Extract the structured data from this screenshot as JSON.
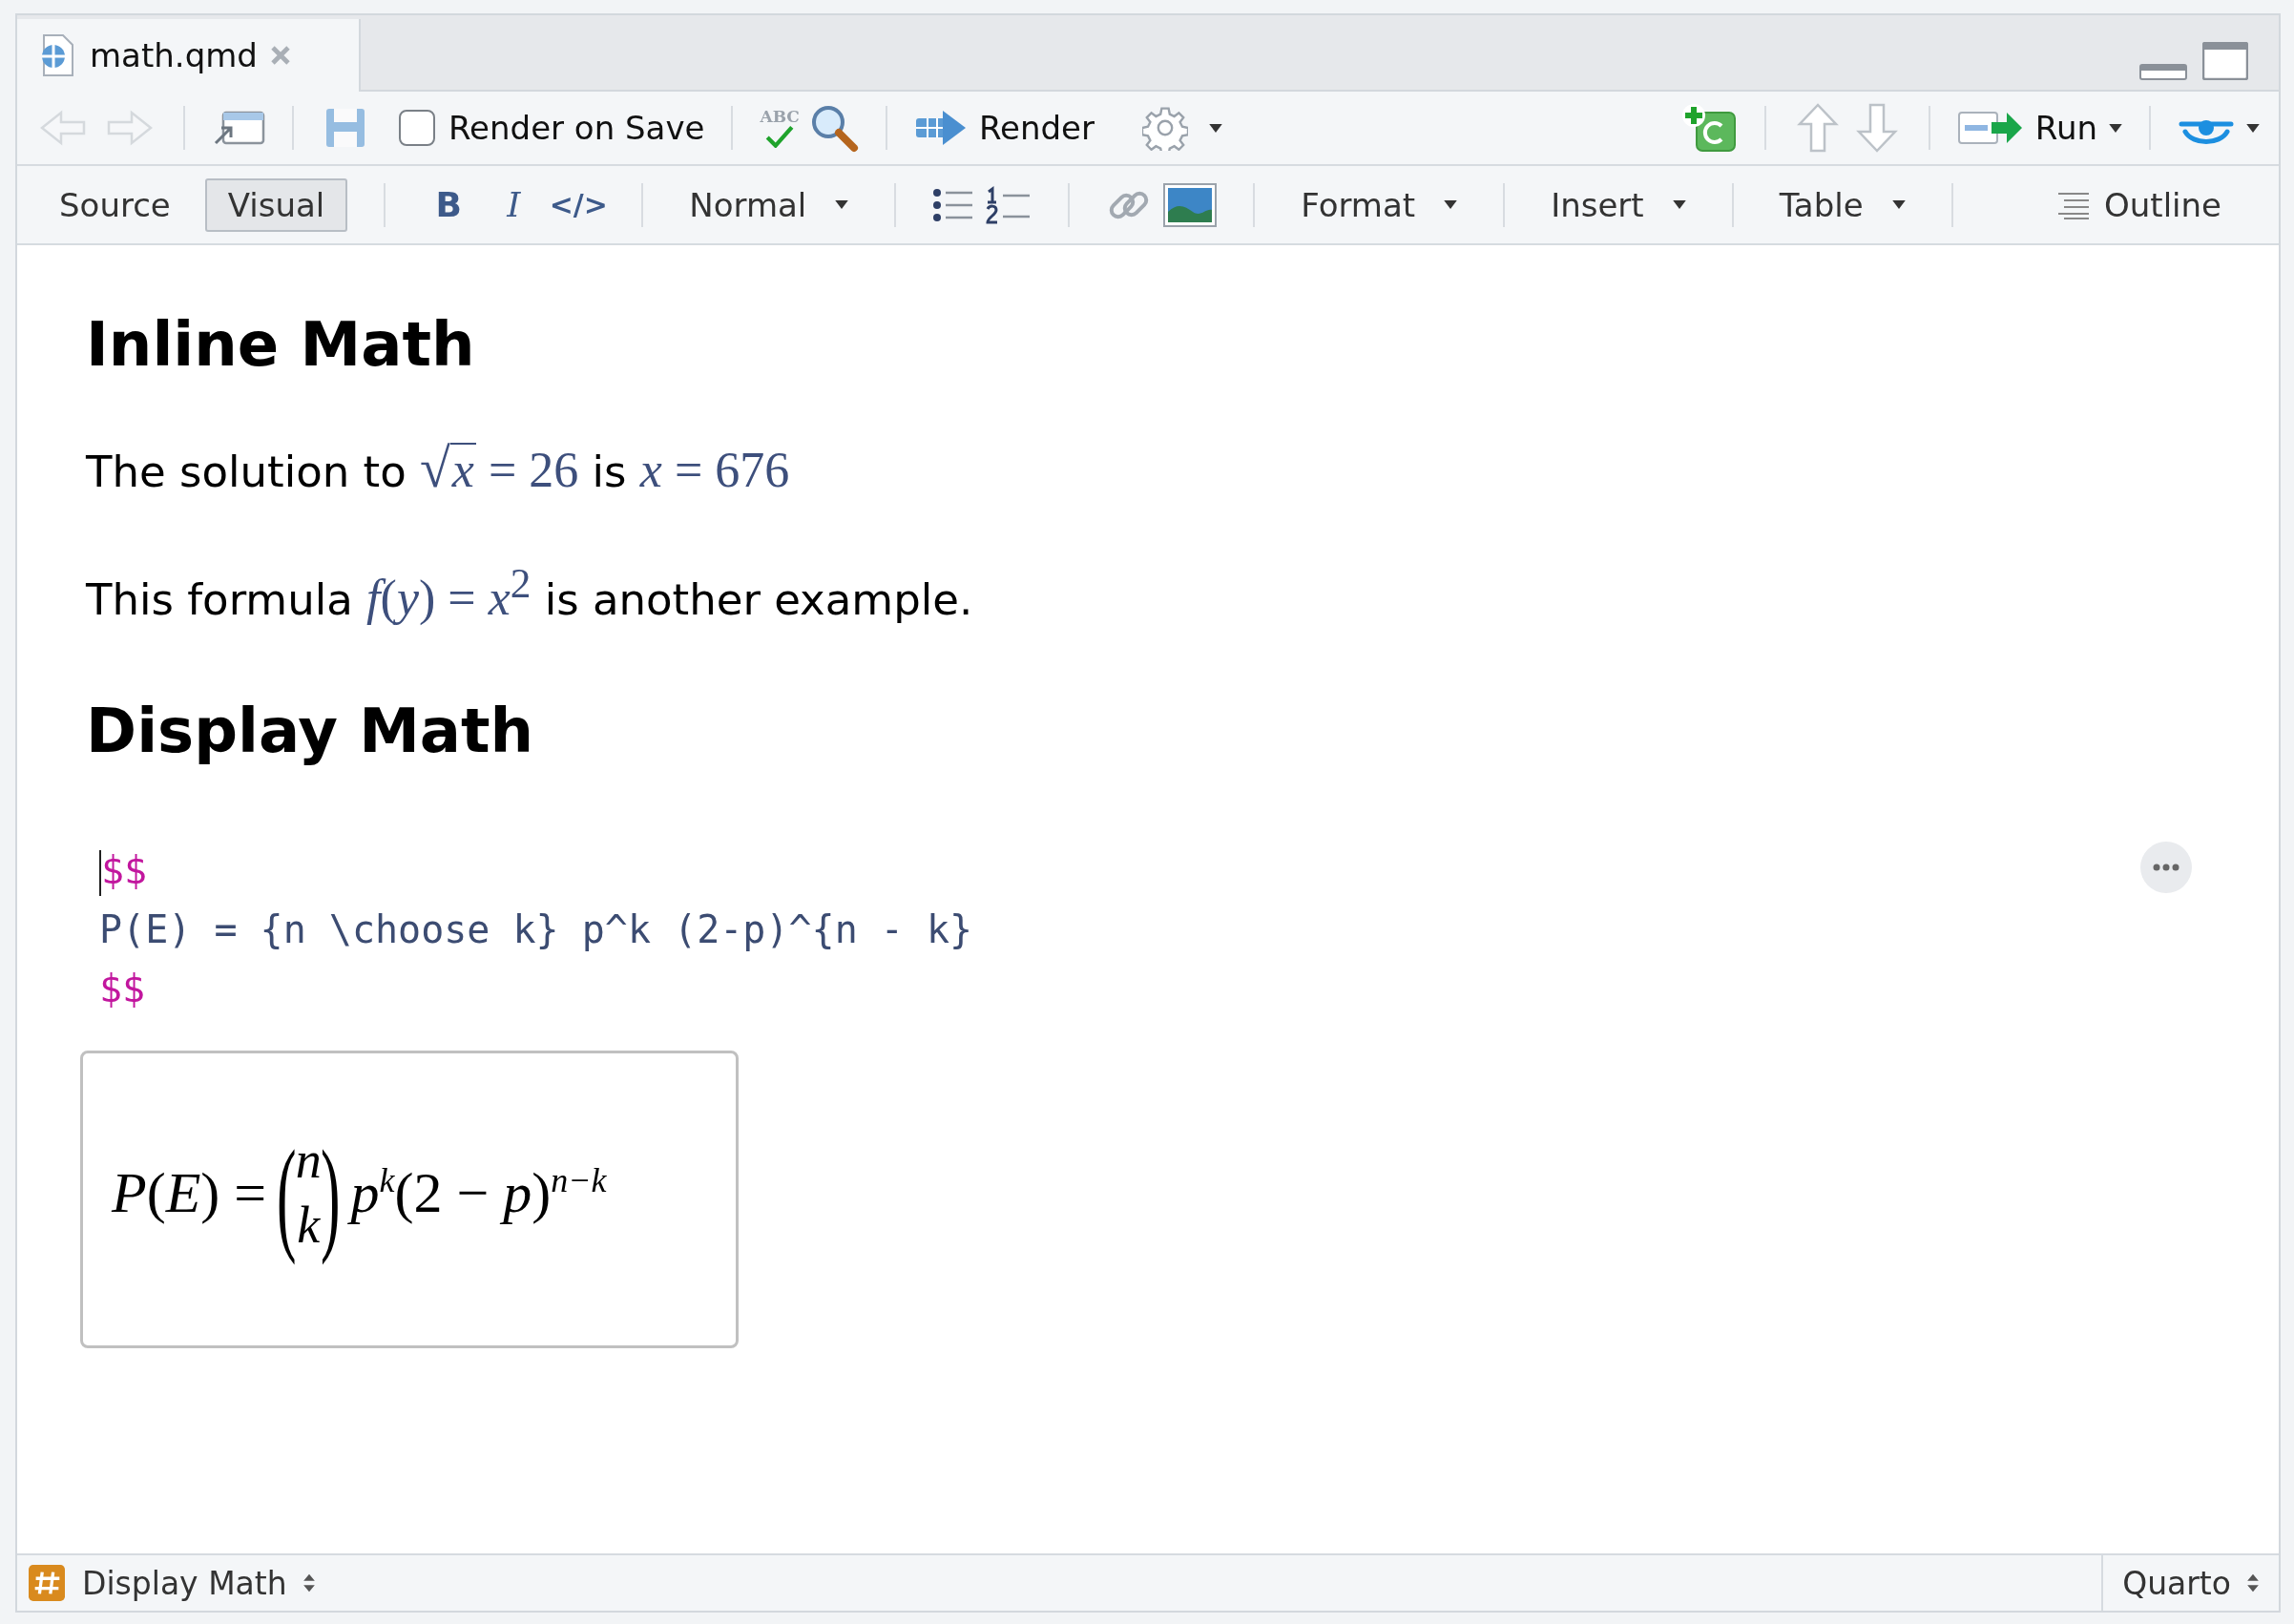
{
  "tab": {
    "title": "math.qmd"
  },
  "toolbar": {
    "nav_disabled": true,
    "save_disabled": true,
    "render_on_save": {
      "label": "Render on Save",
      "checked": false
    },
    "spell_check": "ABC",
    "render": "Render",
    "run": "Run"
  },
  "format_bar": {
    "modes": [
      {
        "label": "Source",
        "selected": false
      },
      {
        "label": "Visual",
        "selected": true
      }
    ],
    "bold": "B",
    "italic": "I",
    "code": "</>",
    "style": "Normal",
    "menus": [
      "Format",
      "Insert",
      "Table"
    ],
    "outline": "Outline"
  },
  "document": [
    {
      "kind": "heading",
      "text": "Inline Math"
    },
    {
      "kind": "paragraph",
      "segments": [
        {
          "kind": "text",
          "text": "The solution to "
        },
        {
          "kind": "sqrt",
          "sign": "√",
          "text": "x"
        },
        {
          "kind": "math",
          "text": " = 26"
        },
        {
          "kind": "text",
          "text": " is "
        },
        {
          "kind": "math",
          "text": "*x* = 676"
        }
      ]
    },
    {
      "kind": "paragraph",
      "segments": [
        {
          "kind": "text",
          "text": "This formula "
        },
        {
          "kind": "math",
          "text": "*f*(*y*) = *x*$^{2}$"
        },
        {
          "kind": "text",
          "text": " is another example."
        }
      ]
    },
    {
      "kind": "heading",
      "text": "Display Math"
    },
    {
      "kind": "code",
      "lines": [
        {
          "kind": "delimiter",
          "text": "$$"
        },
        {
          "kind": "source",
          "text": "P(E) = {n \\choose k} p^k (2-p)^{n - k}"
        },
        {
          "kind": "delimiter",
          "text": "$$"
        }
      ]
    },
    {
      "kind": "equation",
      "lhs": "*P*(*E*) =",
      "binom": {
        "open": "(",
        "top": "n",
        "bottom": "k",
        "close": ")"
      },
      "rhs": "*p*$^{k}$(2 − *p*)$^{n−k}$"
    }
  ],
  "status_bar": {
    "section": "Display Math",
    "mode": "Quarto"
  }
}
